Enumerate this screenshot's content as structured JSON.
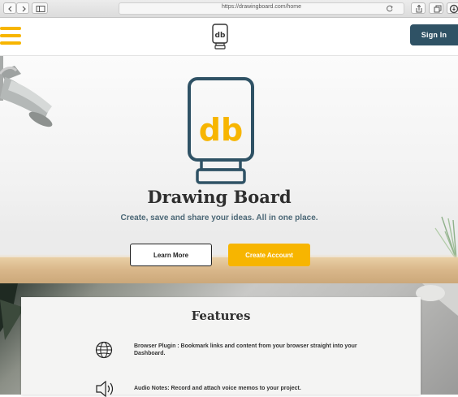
{
  "browser": {
    "url": "https://drawingboard.com/home",
    "buttons": [
      "back-icon",
      "forward-icon",
      "sidebar-icon",
      "share-icon",
      "tabs-icon",
      "downloads-icon"
    ]
  },
  "header": {
    "logo_icon": "db-logo-icon",
    "menu_icon": "hamburger-icon",
    "signin_label": "Sign In"
  },
  "hero": {
    "title": "Drawing Board",
    "tagline": "Create, save and share your ideas.  All in one place.",
    "learn_more_label": "Learn More",
    "create_account_label": "Create Account"
  },
  "features": {
    "title": "Features",
    "items": [
      {
        "icon": "globe-icon",
        "text": "Browser Plugin : Bookmark links and content from your browser straight into your Dashboard."
      },
      {
        "icon": "speaker-icon",
        "text": "Audio Notes: Record and attach voice memos to your project."
      }
    ]
  },
  "colors": {
    "accent": "#f7b500",
    "primary": "#2f5265",
    "title_text": "#2e2e2e",
    "tagline_text": "#4b6776"
  }
}
